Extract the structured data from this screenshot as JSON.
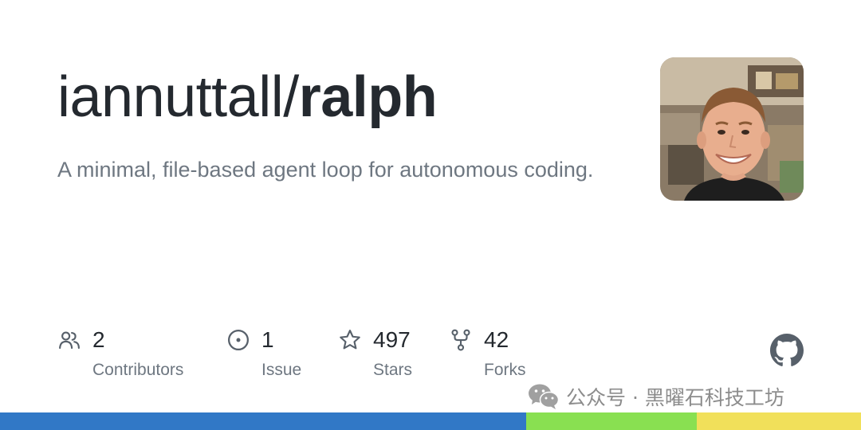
{
  "repo": {
    "owner": "iannuttall/",
    "name": "ralph",
    "description": "A minimal, file-based agent loop for autonomous coding."
  },
  "avatar": {
    "icon": "user-avatar-photo"
  },
  "stats": {
    "contributors": {
      "count": "2",
      "label": "Contributors",
      "icon": "people-icon"
    },
    "issues": {
      "count": "1",
      "label": "Issue",
      "icon": "issue-opened-icon"
    },
    "stars": {
      "count": "497",
      "label": "Stars",
      "icon": "star-icon"
    },
    "forks": {
      "count": "42",
      "label": "Forks",
      "icon": "repo-forked-icon"
    }
  },
  "brand": {
    "icon": "github-mark-icon"
  },
  "watermark": {
    "icon": "wechat-icon",
    "text": "公众号 · 黑曜石科技工坊"
  },
  "language_bar": [
    {
      "share": 0.611,
      "color": "#3178c6"
    },
    {
      "share": 0.198,
      "color": "#89e051"
    },
    {
      "share": 0.191,
      "color": "#f1e05a"
    }
  ],
  "colors": {
    "title": "#24292f",
    "muted": "#6e7781"
  }
}
